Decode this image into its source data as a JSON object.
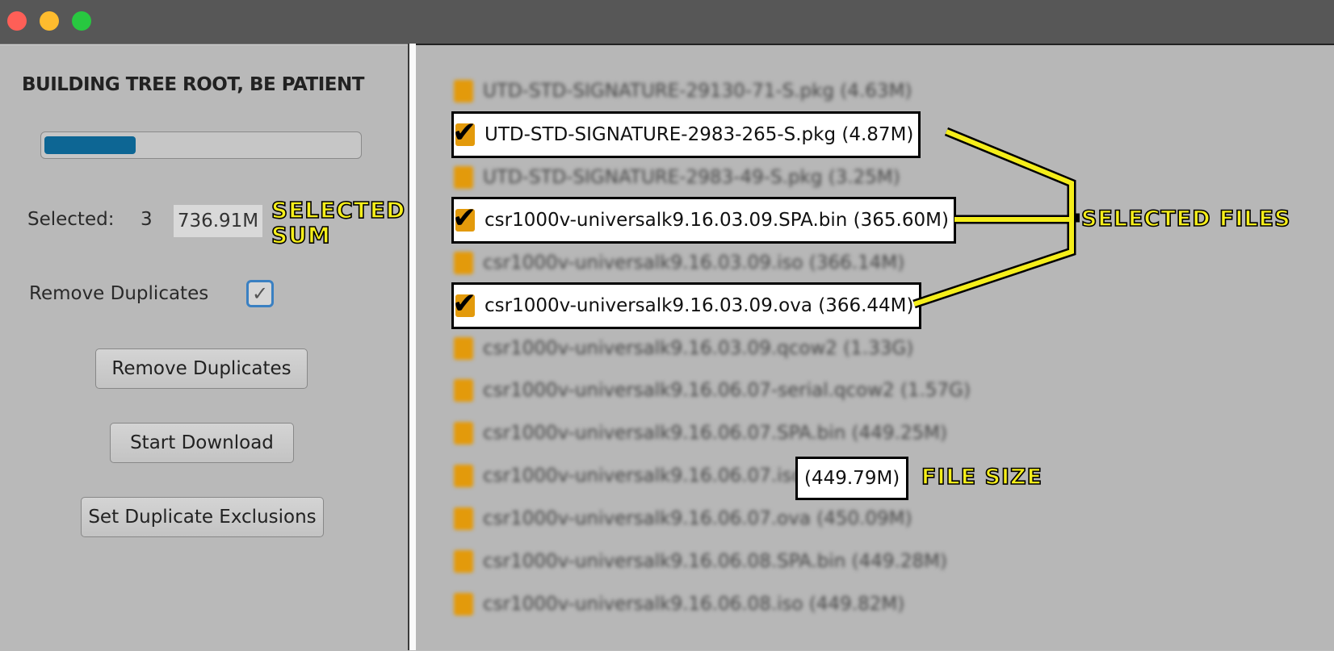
{
  "window": {
    "traffic_lights": [
      {
        "name": "close",
        "color": "#fe5f57"
      },
      {
        "name": "minimize",
        "color": "#febc2e"
      },
      {
        "name": "zoom",
        "color": "#28c840"
      }
    ]
  },
  "left": {
    "status_title": "BUILDING TREE ROOT, BE PATIENT",
    "progress_fraction": 0.29,
    "selected_label": "Selected:",
    "selected_count": "3",
    "selected_sum": "736.91M",
    "remove_duplicates_label": "Remove Duplicates",
    "remove_duplicates_checked": true,
    "checkbox_glyph": "✓",
    "buttons": {
      "remove_duplicates": "Remove Duplicates",
      "start_download": "Start Download",
      "set_exclusions": "Set Duplicate Exclusions"
    }
  },
  "files": [
    {
      "name": "UTD-STD-SIGNATURE-29130-71-S.pkg (4.63M)",
      "selected": false
    },
    {
      "name": "UTD-STD-SIGNATURE-2983-265-S.pkg (4.87M)",
      "selected": true
    },
    {
      "name": "UTD-STD-SIGNATURE-2983-49-S.pkg (3.25M)",
      "selected": false
    },
    {
      "name": "csr1000v-universalk9.16.03.09.SPA.bin (365.60M)",
      "selected": true
    },
    {
      "name": "csr1000v-universalk9.16.03.09.iso (366.14M)",
      "selected": false
    },
    {
      "name": "csr1000v-universalk9.16.03.09.ova (366.44M)",
      "selected": true
    },
    {
      "name": "csr1000v-universalk9.16.03.09.qcow2 (1.33G)",
      "selected": false
    },
    {
      "name": "csr1000v-universalk9.16.06.07-serial.qcow2 (1.57G)",
      "selected": false
    },
    {
      "name": "csr1000v-universalk9.16.06.07.SPA.bin (449.25M)",
      "selected": false
    },
    {
      "name": "csr1000v-universalk9.16.06.07.iso",
      "selected": false
    },
    {
      "name": "csr1000v-universalk9.16.06.07.ova (450.09M)",
      "selected": false
    },
    {
      "name": "csr1000v-universalk9.16.06.08.SPA.bin (449.28M)",
      "selected": false
    },
    {
      "name": "csr1000v-universalk9.16.06.08.iso (449.82M)",
      "selected": false
    }
  ],
  "file_size_highlight": "(449.79M)",
  "check_glyph": "✔",
  "annotations": {
    "selected_sum_line1": "SELECTED",
    "selected_sum_line2": "SUM",
    "selected_files": "SELECTED FILES",
    "file_size": "FILE SIZE"
  },
  "colors": {
    "callout_text": "#f5ee1a",
    "callout_stroke": "#000000",
    "progress_fill": "#0d6694",
    "folder_icon": "#e39a0b"
  }
}
